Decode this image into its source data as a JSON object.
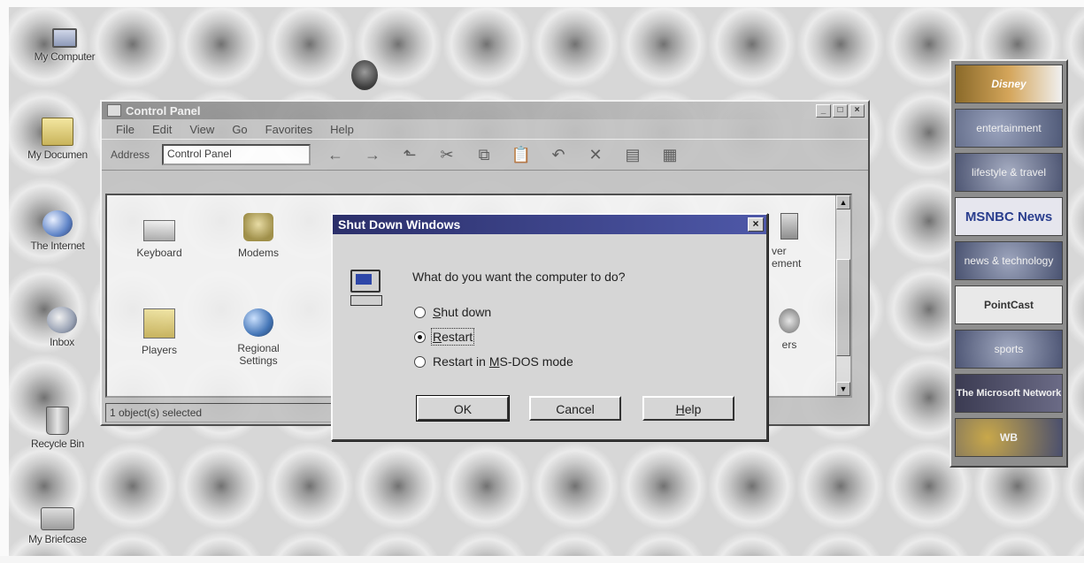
{
  "desktop": {
    "icons": [
      {
        "label": "My Computer"
      },
      {
        "label": "My Documen"
      },
      {
        "label": "The Internet"
      },
      {
        "label": "Inbox"
      },
      {
        "label": "Recycle Bin"
      },
      {
        "label": "My Briefcase"
      }
    ]
  },
  "control_panel": {
    "title": "Control Panel",
    "menu": [
      "File",
      "Edit",
      "View",
      "Go",
      "Favorites",
      "Help"
    ],
    "address_label": "Address",
    "address_value": "Control Panel",
    "items": [
      {
        "label": "Keyboard"
      },
      {
        "label": "Modems"
      },
      {
        "label": "Players"
      },
      {
        "label": "Regional Settings"
      },
      {
        "label": "ver ement"
      },
      {
        "label": "ers"
      }
    ],
    "status": "1 object(s) selected"
  },
  "dialog": {
    "title": "Shut Down Windows",
    "close_glyph": "×",
    "question": "What do you want the computer to do?",
    "options": [
      {
        "accel": "S",
        "rest": "hut down",
        "selected": false
      },
      {
        "accel": "R",
        "rest": "estart",
        "selected": true
      },
      {
        "pre": "Restart in ",
        "accel": "M",
        "rest": "S-DOS mode",
        "selected": false
      }
    ],
    "buttons": {
      "ok": "OK",
      "cancel": "Cancel",
      "help_accel": "H",
      "help_rest": "elp"
    }
  },
  "channel_bar": {
    "channels": [
      {
        "label": "Disney"
      },
      {
        "label": "entertainment"
      },
      {
        "label": "lifestyle & travel"
      },
      {
        "label": "MSNBC News"
      },
      {
        "label": "news & technology"
      },
      {
        "label": "PointCast"
      },
      {
        "label": "sports"
      },
      {
        "label": "The Microsoft Network"
      },
      {
        "label": "WB"
      }
    ]
  }
}
